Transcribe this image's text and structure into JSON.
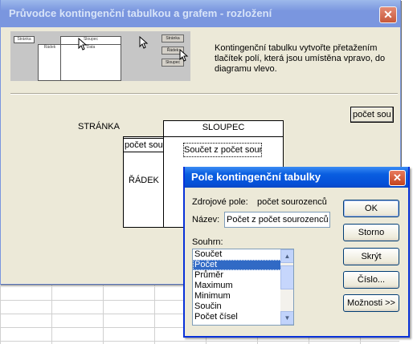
{
  "wizard": {
    "title": "Průvodce kontingenční tabulkou a grafem - rozložení",
    "close_icon": "close-icon",
    "illustration_labels": [
      "Stránka",
      "Řádek",
      "Sloupec",
      "Data"
    ],
    "instructions": "Kontingenční tabulku vytvořte přetažením tlačítek polí, která jsou umístěna vpravo, do diagramu vlevo.",
    "field_button": "počet sou",
    "areas": {
      "page": "STRÁNKA",
      "column": "SLOUPEC",
      "row": "ŘÁDEK",
      "row_field": "počet sou",
      "data_field": "Součet z počet sour"
    }
  },
  "dialog": {
    "title": "Pole kontingenční tabulky",
    "source_label": "Zdrojové pole:",
    "source_value": "počet sourozenců",
    "name_label": "Název:",
    "name_value": "Počet z počet sourozenců",
    "summary_label": "Souhrn:",
    "summary_options": [
      "Součet",
      "Počet",
      "Průměr",
      "Maximum",
      "Minimum",
      "Součin",
      "Počet čísel"
    ],
    "selected_option": "Počet",
    "buttons": {
      "ok": "OK",
      "cancel": "Storno",
      "hide": "Skrýt",
      "number": "Číslo...",
      "options": "Možnosti >>"
    }
  }
}
